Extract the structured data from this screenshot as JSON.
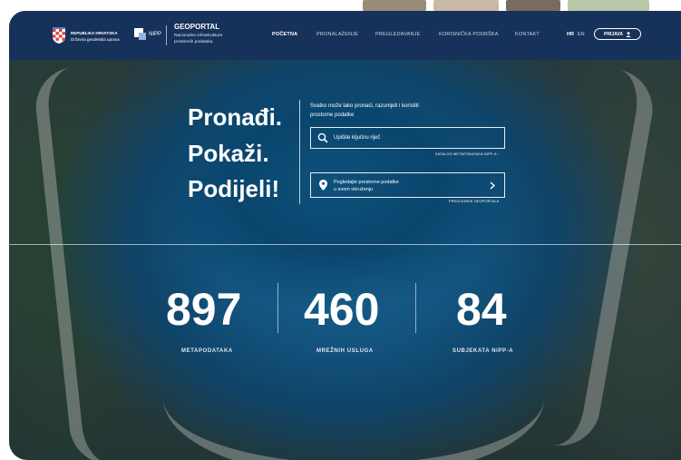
{
  "header": {
    "gov_name": "REPUBLIKA HRVATSKA",
    "gov_agency": "Državna geodetska uprava",
    "nipp_label": "NIPP",
    "portal_title": "GEOPORTAL",
    "portal_subtitle_1": "Nacionalne infrastrukture",
    "portal_subtitle_2": "prostornih podataka",
    "nav": [
      "POČETNA",
      "PRONALAŽENJE",
      "PREGLEDAVANJE",
      "KORISNIČKA PODRŠKA",
      "KONTAKT"
    ],
    "lang_hr": "HR",
    "lang_en": "EN",
    "login_label": "PRIJAVA"
  },
  "hero": {
    "slogan": [
      "Pronađi.",
      "Pokaži.",
      "Podijeli!"
    ],
    "intro_1": "Svatko može lako pronaći, razumjeti i koristiti",
    "intro_2": "prostorne podatke",
    "search_placeholder": "Upišite ključnu riječ",
    "catalog_link": "KATALOG METAPODATAKA NIPP-A ›",
    "view_line_1": "Pogledajte prostorne podatke",
    "view_line_2": "u svom okruženju",
    "browser_link": "PREGLEDNIK GEOPORTALA"
  },
  "stats": [
    {
      "value": "897",
      "label": "METAPODATAKA"
    },
    {
      "value": "460",
      "label": "MREŽNIH USLUGA"
    },
    {
      "value": "84",
      "label": "SUBJEKATA NIPP-A"
    }
  ],
  "colors": {
    "header_bg": "#17325a",
    "text": "#ffffff"
  }
}
